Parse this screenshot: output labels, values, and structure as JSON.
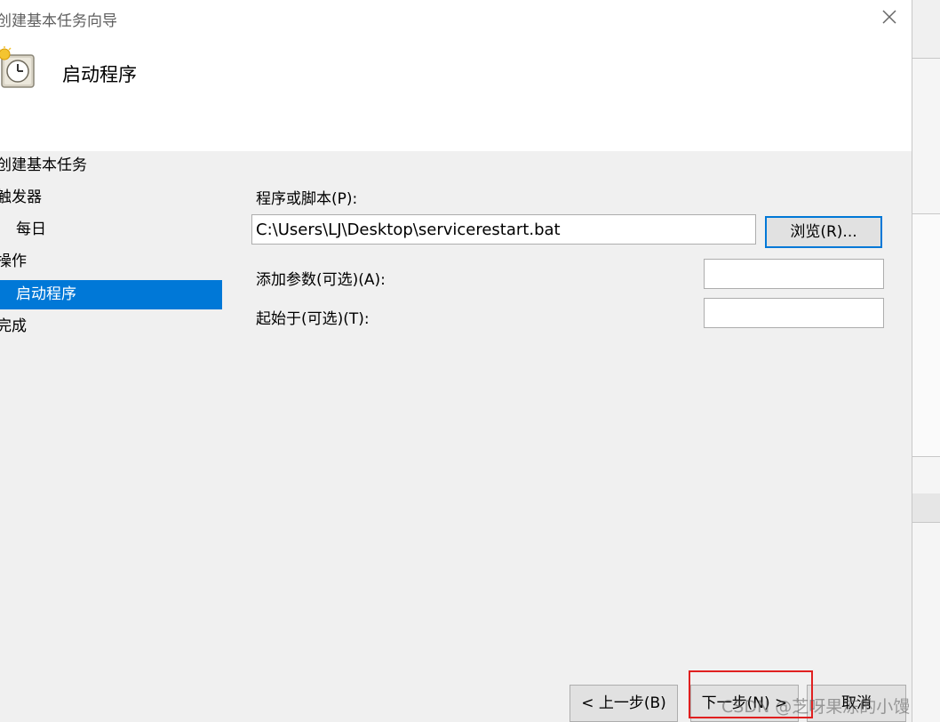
{
  "window": {
    "title": "创建基本任务向导",
    "close_label": "×"
  },
  "header": {
    "icon": "clock-task-icon",
    "heading": "启动程序"
  },
  "steps": [
    {
      "label": "创建基本任务",
      "level": 0,
      "active": false
    },
    {
      "label": "触发器",
      "level": 0,
      "active": false
    },
    {
      "label": "每日",
      "level": 1,
      "active": false
    },
    {
      "label": "操作",
      "level": 0,
      "active": false
    },
    {
      "label": "启动程序",
      "level": 1,
      "active": true
    },
    {
      "label": "完成",
      "level": 0,
      "active": false
    }
  ],
  "form": {
    "program_label": "程序或脚本(P):",
    "program_value": "C:\\Users\\LJ\\Desktop\\servicerestart.bat",
    "browse_label": "浏览(R)...",
    "args_label": "添加参数(可选)(A):",
    "args_value": "",
    "start_in_label": "起始于(可选)(T):",
    "start_in_value": ""
  },
  "footer": {
    "back_label": "< 上一步(B)",
    "next_label": "下一步(N) >",
    "cancel_label": "取消"
  },
  "watermark": "CSDN @芝呀果冻的小馒",
  "colors": {
    "accent": "#0078d7",
    "highlight": "#e02020",
    "background": "#f0f0f0"
  }
}
